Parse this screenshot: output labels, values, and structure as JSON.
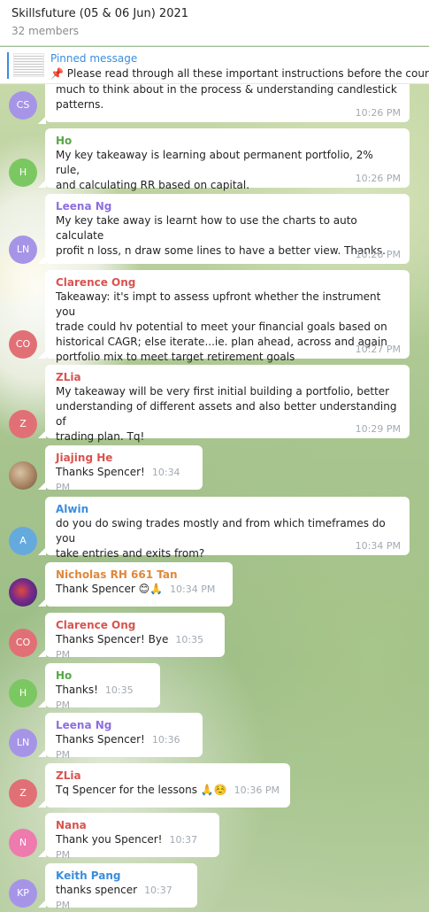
{
  "header": {
    "title": "Skillsfuture (05 & 06 Jun) 2021",
    "members": "32 members"
  },
  "pinned": {
    "title": "Pinned message",
    "icon": "pin-icon",
    "text": "📌  Please read through all these important instructions before the course:"
  },
  "colors": {
    "link": "#3a8dde",
    "avatar_purple": "#a695e7",
    "avatar_green": "#7bc862",
    "avatar_red": "#e17076",
    "avatar_blue": "#65aadd",
    "avatar_pink": "#ee7aae"
  },
  "messages": [
    {
      "avatar": "CS",
      "name": "",
      "lines": [
        "much to think about in the process & understanding candlestick",
        "patterns."
      ],
      "time": "10:26 PM"
    },
    {
      "avatar": "H",
      "name": "Ho",
      "lines": [
        "My key takeaway is learning about permanent portfolio, 2% rule,",
        "and calculating RR based on capital."
      ],
      "time": "10:26 PM"
    },
    {
      "avatar": "LN",
      "name": "Leena Ng",
      "lines": [
        "My key take away is learnt how to use the charts to auto calculate",
        "profit n loss, n draw some lines to have a better view. Thanks."
      ],
      "time": "10:26 PM"
    },
    {
      "avatar": "CO",
      "name": "Clarence Ong",
      "lines": [
        "Takeaway: it's impt to assess upfront whether the instrument you",
        "trade could hv potential to meet your financial goals based on",
        "historical CAGR; else iterate...ie. plan ahead, across and again",
        "portfolio mix to meet target retirement goals"
      ],
      "time": "10:27 PM"
    },
    {
      "avatar": "Z",
      "name": "ZLia",
      "lines": [
        "My takeaway will be very first initial building a portfolio, better",
        "understanding of different assets and also better understanding of",
        "trading plan. Tq!"
      ],
      "time": "10:29 PM"
    },
    {
      "avatar": "",
      "name": "Jiajing He",
      "lines": [
        "Thanks Spencer!"
      ],
      "time": "10:34 PM"
    },
    {
      "avatar": "A",
      "name": "Alwin",
      "lines": [
        "do you do swing trades mostly and from which timeframes do you",
        "take entries and exits from?"
      ],
      "time": "10:34 PM"
    },
    {
      "avatar": "",
      "name": "Nicholas RH 661 Tan",
      "lines": [
        "Thank Spencer 😊🙏"
      ],
      "time": "10:34 PM"
    },
    {
      "avatar": "CO",
      "name": "Clarence Ong",
      "lines": [
        "Thanks Spencer! Bye"
      ],
      "time": "10:35 PM"
    },
    {
      "avatar": "H",
      "name": "Ho",
      "lines": [
        "Thanks!"
      ],
      "time": "10:35 PM"
    },
    {
      "avatar": "LN",
      "name": "Leena Ng",
      "lines": [
        "Thanks Spencer!"
      ],
      "time": "10:36 PM"
    },
    {
      "avatar": "Z",
      "name": "ZLia",
      "lines": [
        "Tq Spencer for the lessons 🙏☺️"
      ],
      "time": "10:36 PM"
    },
    {
      "avatar": "N",
      "name": "Nana",
      "lines": [
        "Thank you Spencer!"
      ],
      "time": "10:37 PM"
    },
    {
      "avatar": "KP",
      "name": "Keith Pang",
      "lines": [
        "thanks spencer"
      ],
      "time": "10:37 PM"
    }
  ]
}
